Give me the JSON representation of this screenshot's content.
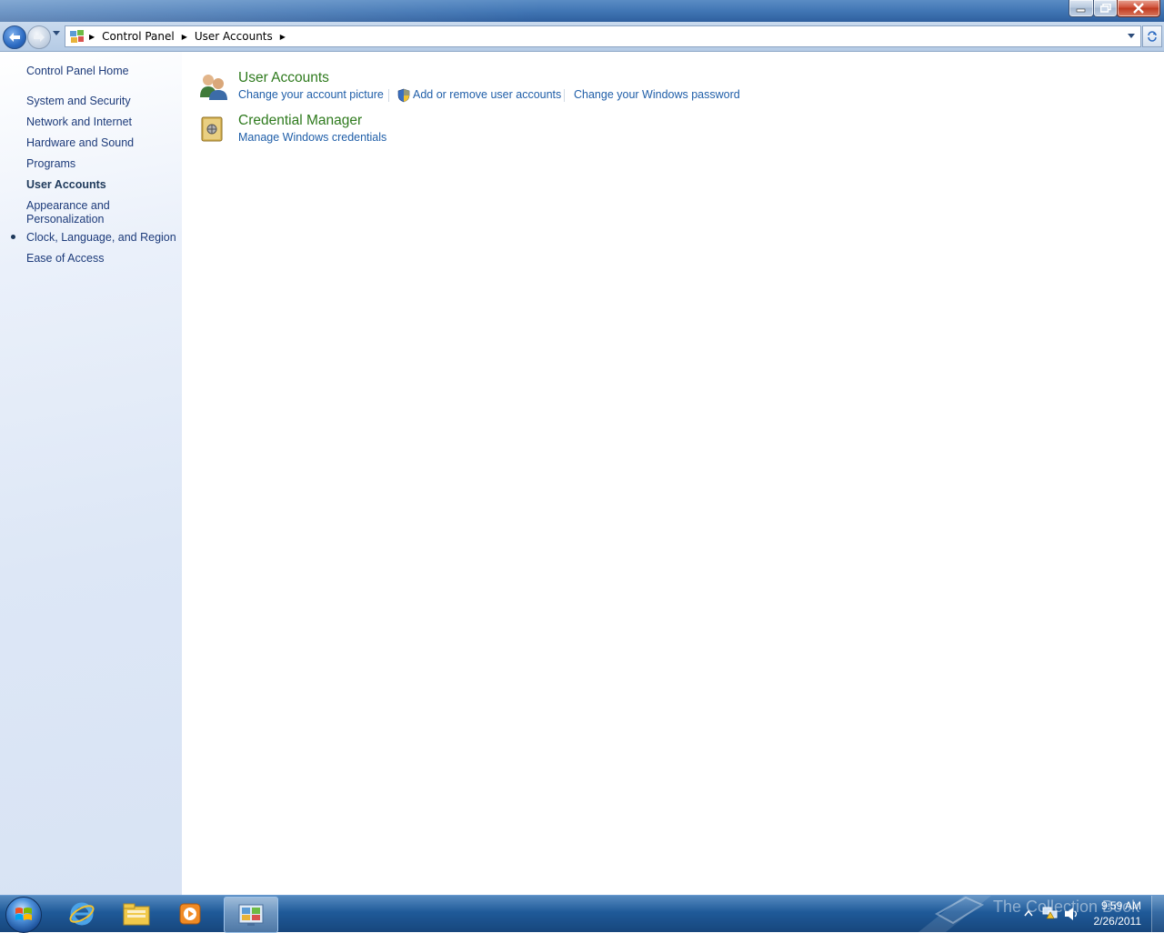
{
  "window": {
    "caption_buttons": [
      "minimize-icon",
      "restore-icon",
      "close-icon"
    ]
  },
  "address": {
    "crumbs": [
      "Control Panel",
      "User Accounts"
    ]
  },
  "left_nav": {
    "home": "Control Panel Home",
    "items": [
      "System and Security",
      "Network and Internet",
      "Hardware and Sound",
      "Programs",
      "User Accounts",
      "Appearance and Personalization",
      "Clock, Language, and Region",
      "Ease of Access"
    ],
    "current": "User Accounts"
  },
  "categories": [
    {
      "title": "User Accounts",
      "icon": "users-icon",
      "tasks": [
        "Change your account picture",
        "Add or remove user accounts",
        "Change your Windows password"
      ]
    },
    {
      "title": "Credential Manager",
      "icon": "vault-icon",
      "tasks": [
        "Manage Windows credentials"
      ]
    }
  ],
  "taskbar": {
    "pinned": [
      "internet-explorer-icon",
      "windows-explorer-icon",
      "media-player-icon",
      "control-panel-icon"
    ],
    "watermark": "The Collection Book",
    "time": "9:59 AM",
    "date": "2/26/2011"
  },
  "colors": {
    "category_title": "#2e7a1d",
    "task_link": "#1f5ea8",
    "nav_link": "#1d3b7a"
  }
}
